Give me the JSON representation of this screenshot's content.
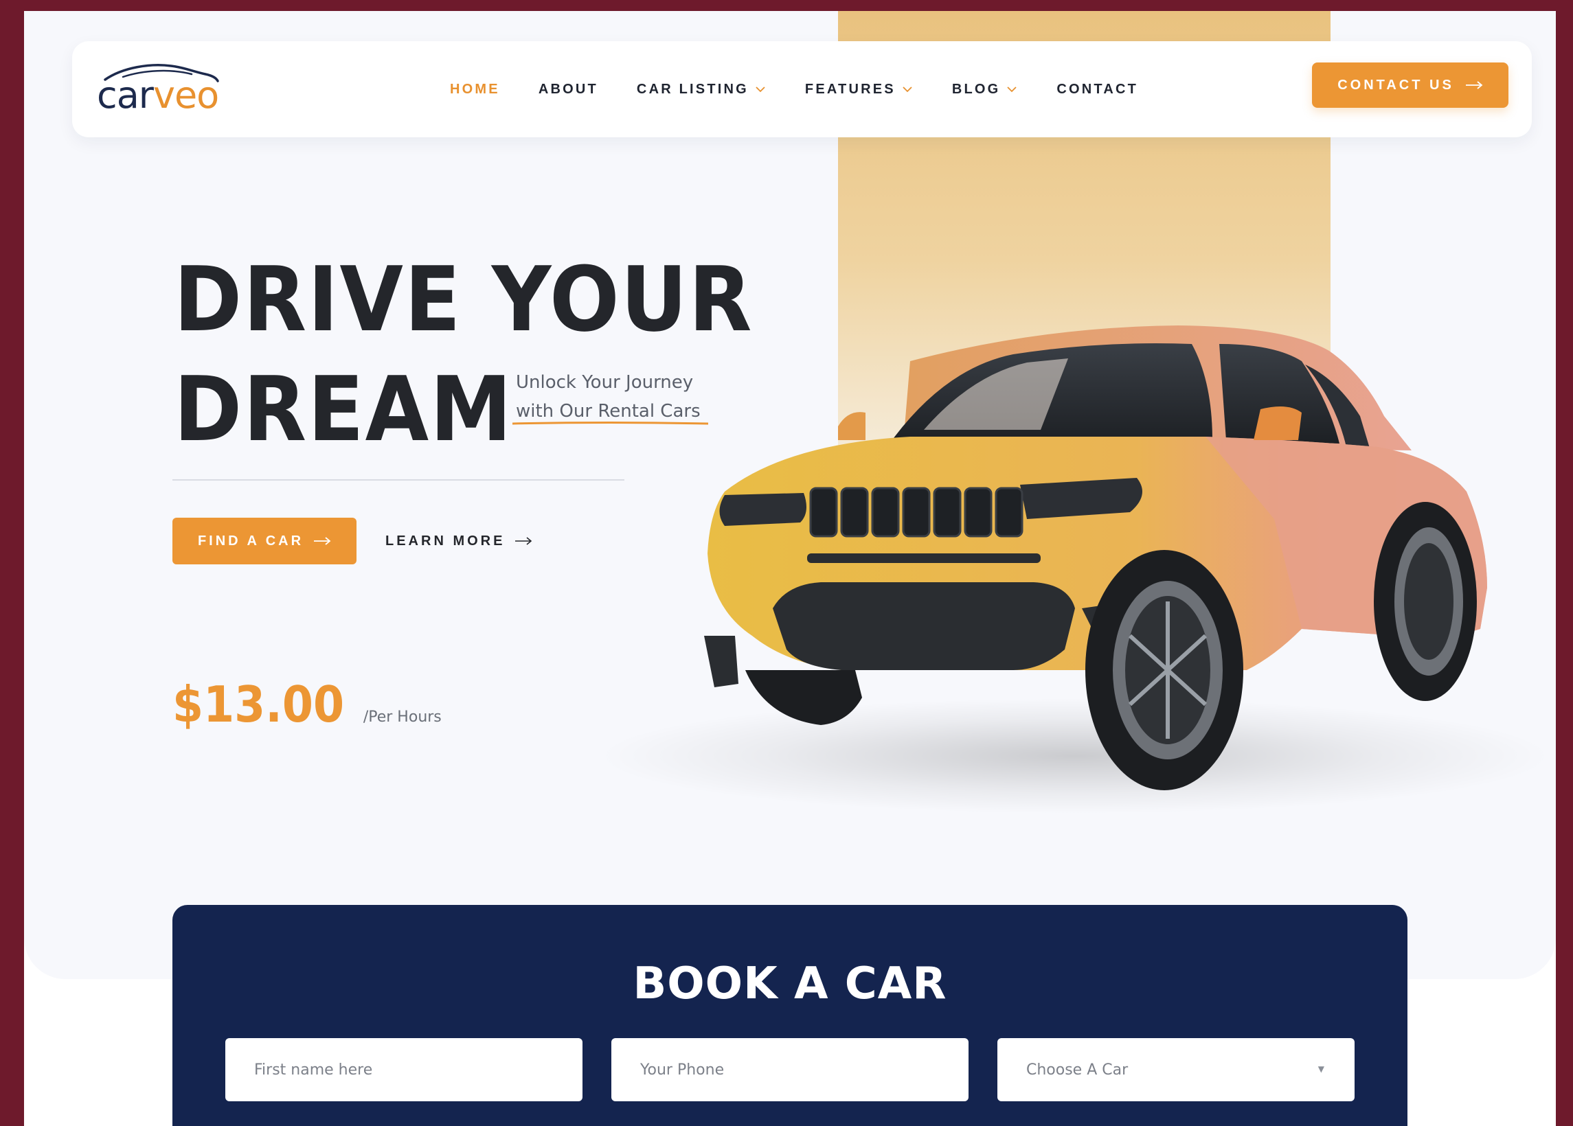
{
  "brand": {
    "logo_part1": "car",
    "logo_part2": "veo",
    "primary_color": "#e8912f",
    "navy_color": "#14244f"
  },
  "nav": {
    "items": [
      {
        "label": "HOME",
        "active": true,
        "dropdown": false
      },
      {
        "label": "ABOUT",
        "active": false,
        "dropdown": false
      },
      {
        "label": "CAR LISTING",
        "active": false,
        "dropdown": true
      },
      {
        "label": "FEATURES",
        "active": false,
        "dropdown": true
      },
      {
        "label": "BLOG",
        "active": false,
        "dropdown": true
      },
      {
        "label": "CONTACT",
        "active": false,
        "dropdown": false
      }
    ],
    "cta_label": "CONTACT US",
    "cta_icon": "arrow-right-icon"
  },
  "hero": {
    "headline_line1": "DRIVE YOUR",
    "headline_line2": "DREAM",
    "tagline_line1": "Unlock Your Journey",
    "tagline_line2": "with Our Rental Cars",
    "primary_button": "FIND A CAR",
    "secondary_button": "LEARN MORE",
    "price": "$13.00",
    "price_unit": "/Per Hours"
  },
  "booking": {
    "title": "BOOK A CAR",
    "first_name_placeholder": "First name here",
    "phone_placeholder": "Your Phone",
    "car_select_value": "Choose A Car"
  }
}
